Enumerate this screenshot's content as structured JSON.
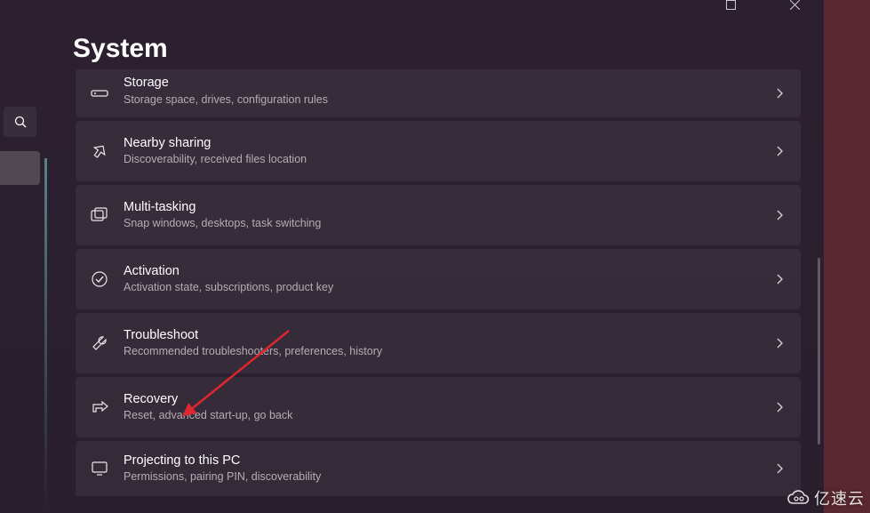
{
  "page": {
    "title": "System"
  },
  "items": [
    {
      "key": "storage",
      "title": "Storage",
      "desc": "Storage space, drives, configuration rules"
    },
    {
      "key": "nearby",
      "title": "Nearby sharing",
      "desc": "Discoverability, received files location"
    },
    {
      "key": "multitask",
      "title": "Multi-tasking",
      "desc": "Snap windows, desktops, task switching"
    },
    {
      "key": "activation",
      "title": "Activation",
      "desc": "Activation state, subscriptions, product key"
    },
    {
      "key": "troubleshoot",
      "title": "Troubleshoot",
      "desc": "Recommended troubleshooters, preferences, history"
    },
    {
      "key": "recovery",
      "title": "Recovery",
      "desc": "Reset, advanced start-up, go back"
    },
    {
      "key": "projecting",
      "title": "Projecting to this PC",
      "desc": "Permissions, pairing PIN, discoverability"
    }
  ],
  "watermark": "亿速云",
  "icons": {
    "storage": "storage-icon",
    "nearby": "share-icon",
    "multitask": "multitask-icon",
    "activation": "check-circle-icon",
    "troubleshoot": "tools-icon",
    "recovery": "recovery-icon",
    "projecting": "project-icon"
  }
}
